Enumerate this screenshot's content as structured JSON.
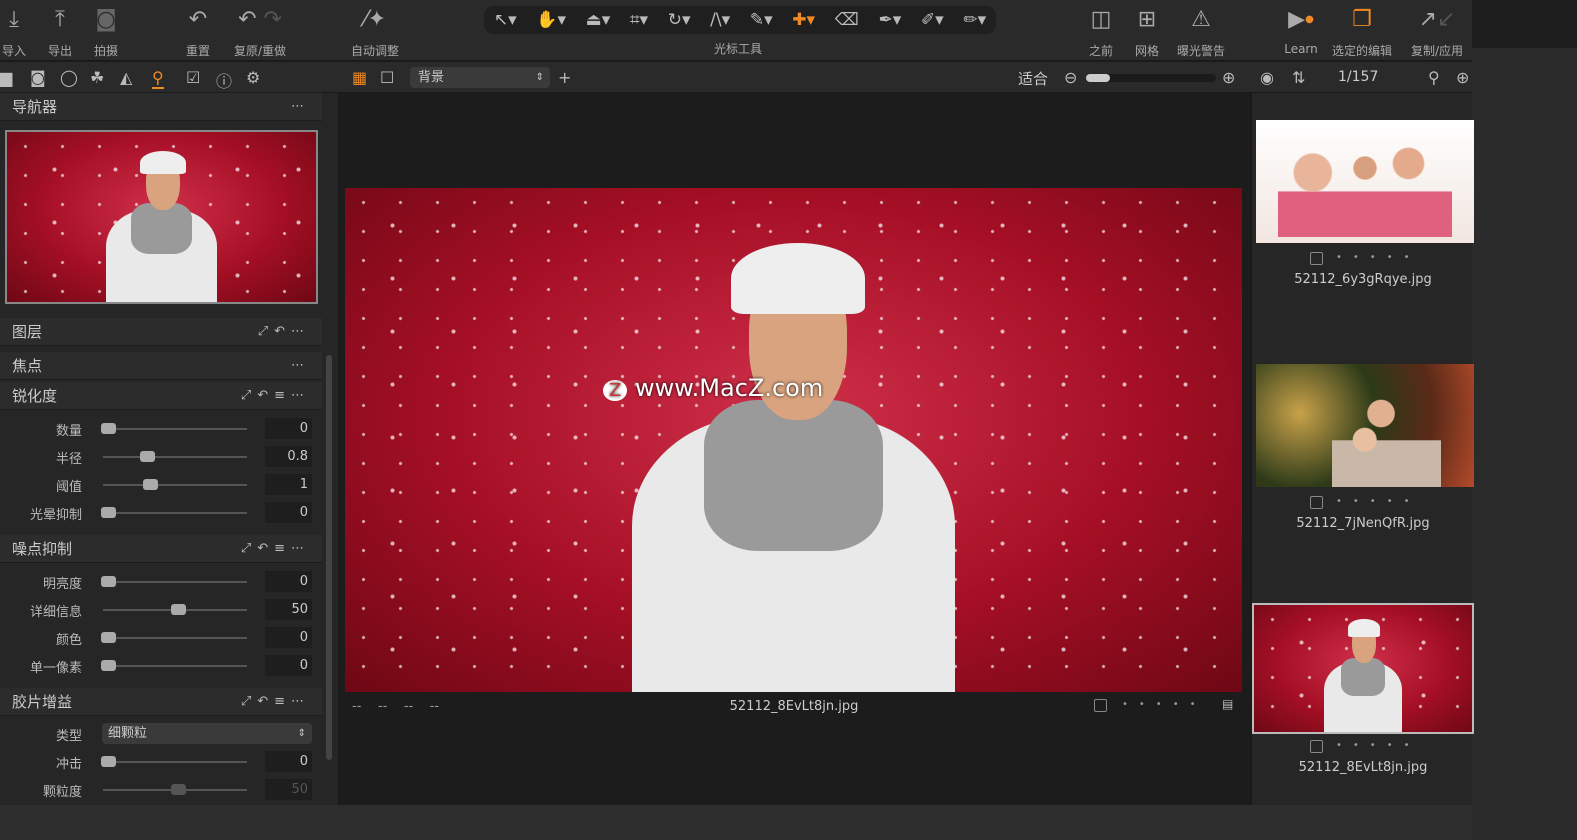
{
  "toolbar": {
    "import": "导入",
    "export": "导出",
    "capture": "拍摄",
    "reset": "重置",
    "undo_redo": "复原/重做",
    "auto_adjust": "自动调整",
    "cursor_tools": "光标工具",
    "before": "之前",
    "grid": "网格",
    "exposure_warning": "曝光警告",
    "learn": "Learn",
    "selected_edits": "选定的编辑",
    "copy_apply": "复制/应用"
  },
  "subbar": {
    "layer_select": "背景",
    "fit": "适合",
    "counter": "1/157"
  },
  "left": {
    "navigator": "导航器",
    "layers": "图层",
    "focus": "焦点",
    "sharpening": {
      "title": "锐化度",
      "rows": [
        {
          "label": "数量",
          "value": "0",
          "pos": 0
        },
        {
          "label": "半径",
          "value": "0.8",
          "pos": 0.28
        },
        {
          "label": "阈值",
          "value": "1",
          "pos": 0.3
        },
        {
          "label": "光晕抑制",
          "value": "0",
          "pos": 0
        }
      ]
    },
    "noise": {
      "title": "噪点抑制",
      "rows": [
        {
          "label": "明亮度",
          "value": "0",
          "pos": 0
        },
        {
          "label": "详细信息",
          "value": "50",
          "pos": 0.5
        },
        {
          "label": "颜色",
          "value": "0",
          "pos": 0
        },
        {
          "label": "单一像素",
          "value": "0",
          "pos": 0
        }
      ]
    },
    "grain": {
      "title": "胶片增益",
      "type_label": "类型",
      "type_value": "细颗粒",
      "rows": [
        {
          "label": "冲击",
          "value": "0",
          "pos": 0
        },
        {
          "label": "颗粒度",
          "value": "50",
          "pos": 0.5
        }
      ]
    }
  },
  "viewer": {
    "filename": "52112_8EvLt8jn.jpg",
    "meta": "--    --    --    --",
    "watermark": "www.MacZ.com"
  },
  "film": [
    {
      "name": "52112_6y3gRqye.jpg"
    },
    {
      "name": "52112_7jNenQfR.jpg"
    },
    {
      "name": "52112_8EvLt8jn.jpg",
      "selected": true
    }
  ],
  "colors": {
    "accent": "#f08a24",
    "bg": "#262626"
  }
}
